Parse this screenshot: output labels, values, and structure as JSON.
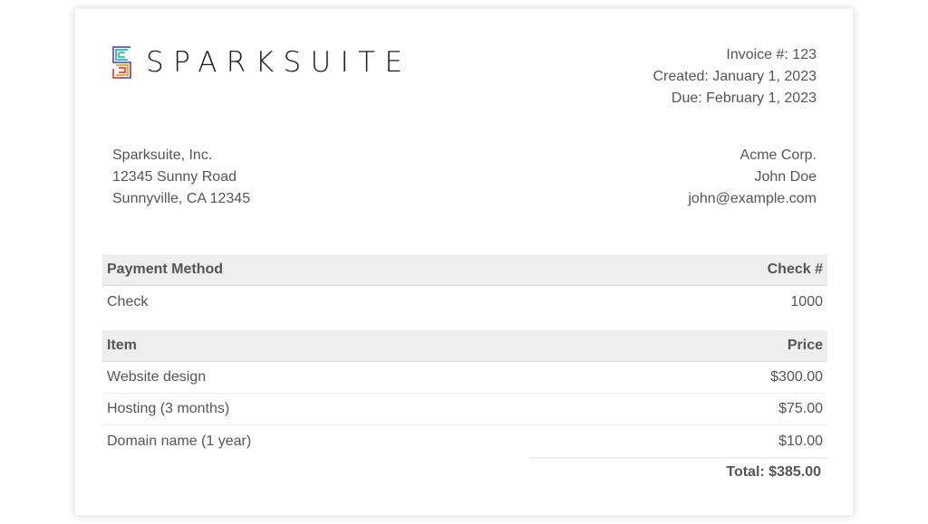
{
  "logo": {
    "text": "SPARKSUITE",
    "icon": "sparksuite-logo-icon",
    "colors": [
      "#f05a4c",
      "#3fb6e8",
      "#5bc28a",
      "#f1a93b",
      "#6b6ebf"
    ]
  },
  "invoice": {
    "number": "Invoice #: 123",
    "created": "Created: January 1, 2023",
    "due": "Due: February 1, 2023"
  },
  "from": {
    "company": "Sparksuite, Inc.",
    "address1": "12345 Sunny Road",
    "address2": "Sunnyville, CA 12345"
  },
  "to": {
    "company": "Acme Corp.",
    "name": "John Doe",
    "email": "john@example.com"
  },
  "payment": {
    "header_method": "Payment Method",
    "header_check": "Check #",
    "method": "Check",
    "check_number": "1000"
  },
  "items": {
    "header_item": "Item",
    "header_price": "Price",
    "rows": [
      {
        "name": "Website design",
        "price": "$300.00"
      },
      {
        "name": "Hosting (3 months)",
        "price": "$75.00"
      },
      {
        "name": "Domain name (1 year)",
        "price": "$10.00"
      }
    ],
    "total": "Total: $385.00"
  }
}
